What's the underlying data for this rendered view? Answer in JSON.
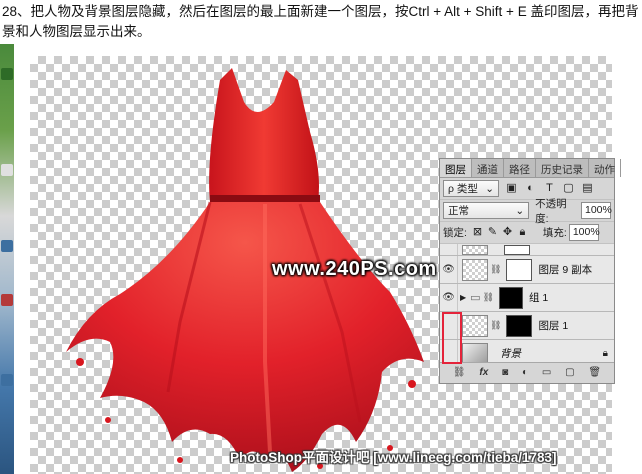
{
  "instruction": "28、把人物及背景图层隐藏，然后在图层的最上面新建一个图层，按Ctrl + Alt + Shift + E 盖印图层，再把背景和人物图层显示出来。",
  "watermark": "www.240PS.com",
  "credit": "PhotoShop平面设计吧 [www.lineeg.com/tieba/1783]",
  "panel": {
    "tabs": [
      "图层",
      "通道",
      "路径",
      "历史记录",
      "动作"
    ],
    "filter": {
      "label": "ρ 类型",
      "icons": [
        "image-filter-icon",
        "adjustment-filter-icon",
        "type-filter-icon",
        "shape-filter-icon",
        "smart-filter-icon"
      ]
    },
    "blend_mode": "正常",
    "opacity_label": "不透明度:",
    "opacity_value": "100%",
    "lock_label": "锁定:",
    "fill_label": "填充:",
    "fill_value": "100%",
    "layers": [
      {
        "name": "图层 9 副本",
        "visible": true,
        "type": "layer"
      },
      {
        "name": "组 1",
        "visible": true,
        "type": "group"
      },
      {
        "name": "图层 1",
        "visible": false,
        "type": "layer"
      },
      {
        "name": "背景",
        "visible": false,
        "type": "background"
      }
    ],
    "bottom_icons": [
      "link-icon",
      "fx-icon",
      "mask-icon",
      "adjustment-icon",
      "folder-icon",
      "new-layer-icon",
      "trash-icon"
    ],
    "fx_label": "fx"
  },
  "colors": {
    "dress": "#e8202a",
    "highlight_box": "#e4233a"
  }
}
